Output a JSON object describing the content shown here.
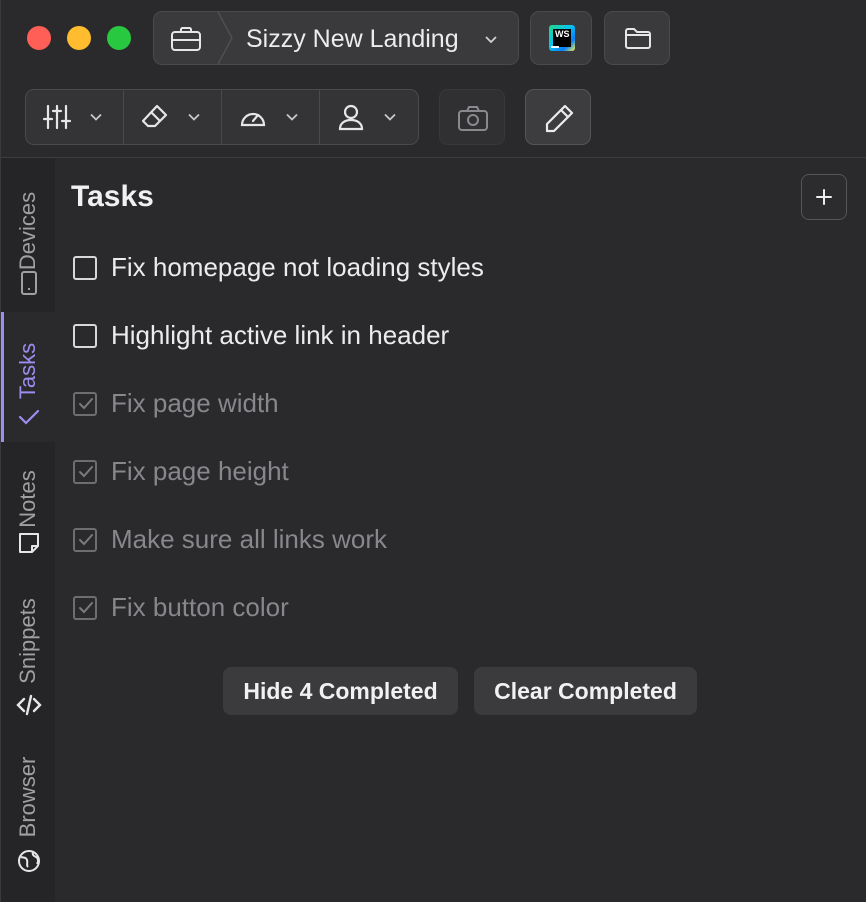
{
  "titlebar": {
    "project_name": "Sizzy New Landing",
    "icons": [
      "briefcase-icon",
      "chevron-down-icon",
      "webstorm-icon",
      "folder-icon"
    ],
    "webstorm_logo_text": "WS"
  },
  "toolbar": {
    "groups": [
      "sliders-icon",
      "eraser-icon",
      "speedometer-icon",
      "user-icon"
    ],
    "camera_icon": "camera-icon",
    "pencil_icon": "pencil-icon"
  },
  "sidebar": {
    "tabs": [
      {
        "label": "Devices",
        "icon": "phone-icon"
      },
      {
        "label": "Tasks",
        "icon": "check-icon",
        "active": true
      },
      {
        "label": "Notes",
        "icon": "sticky-note-icon"
      },
      {
        "label": "Snippets",
        "icon": "code-icon"
      },
      {
        "label": "Browser",
        "icon": "globe-icon"
      }
    ],
    "accent": "#9d8df1"
  },
  "tasks_panel": {
    "title": "Tasks",
    "add_icon": "plus-icon",
    "tasks": [
      {
        "text": "Fix homepage not loading styles",
        "done": false
      },
      {
        "text": "Highlight active link in header",
        "done": false
      },
      {
        "text": "Fix page width",
        "done": true
      },
      {
        "text": "Fix page height",
        "done": true
      },
      {
        "text": "Make sure all links work",
        "done": true
      },
      {
        "text": "Fix button color",
        "done": true
      }
    ],
    "hide_completed_label": "Hide 4 Completed",
    "clear_completed_label": "Clear Completed"
  }
}
